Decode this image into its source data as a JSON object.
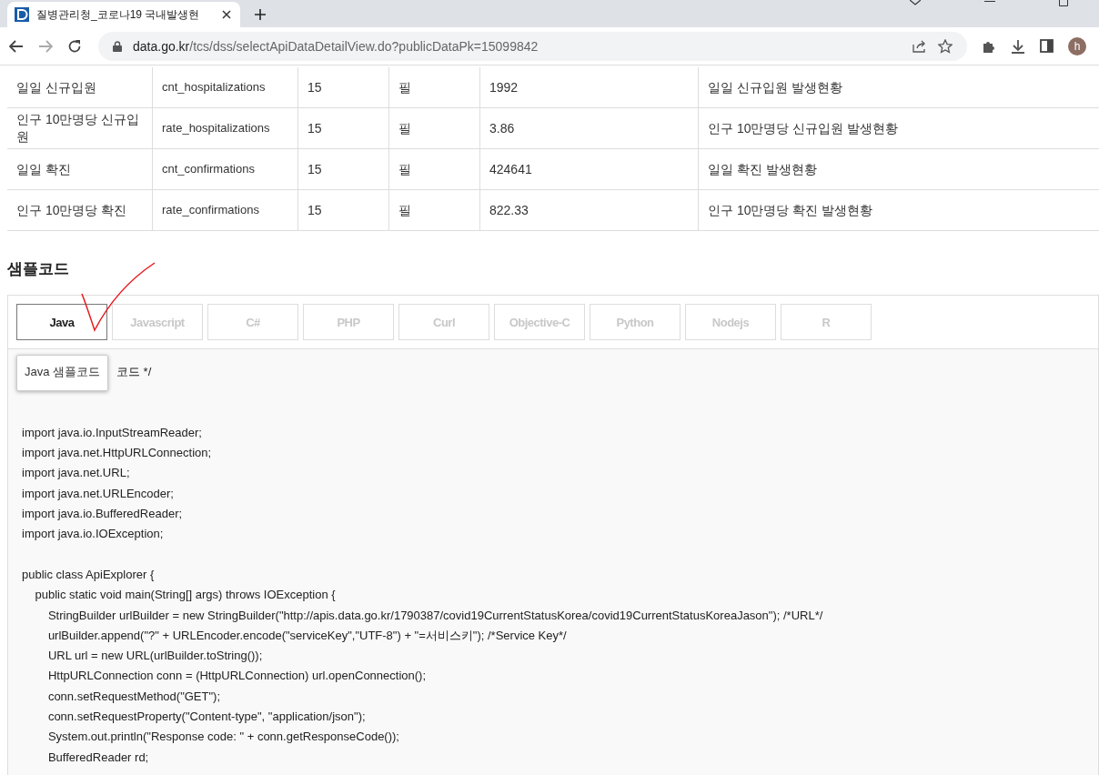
{
  "browser": {
    "tab_title": "질병관리청_코로나19 국내발생현",
    "url_host": "data.go.kr",
    "url_path": "/tcs/dss/selectApiDataDetailView.do?publicDataPk=15099842",
    "avatar_letter": "h"
  },
  "table": {
    "rows": [
      {
        "cells": [
          "일일 신규입원",
          "cnt_hospitalizations",
          "15",
          "필",
          "1992",
          "일일 신규입원 발생현황"
        ]
      },
      {
        "cells": [
          "인구 10만명당 신규입원",
          "rate_hospitalizations",
          "15",
          "필",
          "3.86",
          "인구 10만명당 신규입원 발생현황"
        ]
      },
      {
        "cells": [
          "일일 확진",
          "cnt_confirmations",
          "15",
          "필",
          "424641",
          "일일 확진 발생현황"
        ]
      },
      {
        "cells": [
          "인구 10만명당 확진",
          "rate_confirmations",
          "15",
          "필",
          "822.33",
          "인구 10만명당 확진 발생현황"
        ]
      }
    ]
  },
  "sample_code": {
    "heading": "샘플코드",
    "tabs": [
      {
        "label": "Java",
        "selected": true
      },
      {
        "label": "Javascript",
        "selected": false
      },
      {
        "label": "C#",
        "selected": false
      },
      {
        "label": "PHP",
        "selected": false
      },
      {
        "label": "Curl",
        "selected": false
      },
      {
        "label": "Objective-C",
        "selected": false
      },
      {
        "label": "Python",
        "selected": false
      },
      {
        "label": "Nodejs",
        "selected": false
      },
      {
        "label": "R",
        "selected": false
      }
    ],
    "tooltip": "Java 샘플코드",
    "code_blocks": [
      [
        "코드 */"
      ],
      [
        "import java.io.InputStreamReader;",
        "import java.net.HttpURLConnection;",
        "import java.net.URL;",
        "import java.net.URLEncoder;",
        "import java.io.BufferedReader;",
        "import java.io.IOException;"
      ],
      [
        "public class ApiExplorer {",
        "    public static void main(String[] args) throws IOException {",
        "        StringBuilder urlBuilder = new StringBuilder(\"http://apis.data.go.kr/1790387/covid19CurrentStatusKorea/covid19CurrentStatusKoreaJason\"); /*URL*/",
        "        urlBuilder.append(\"?\" + URLEncoder.encode(\"serviceKey\",\"UTF-8\") + \"=서비스키\"); /*Service Key*/",
        "        URL url = new URL(urlBuilder.toString());",
        "        HttpURLConnection conn = (HttpURLConnection) url.openConnection();",
        "        conn.setRequestMethod(\"GET\");",
        "        conn.setRequestProperty(\"Content-type\", \"application/json\");",
        "        System.out.println(\"Response code: \" + conn.getResponseCode());",
        "        BufferedReader rd;"
      ]
    ]
  }
}
